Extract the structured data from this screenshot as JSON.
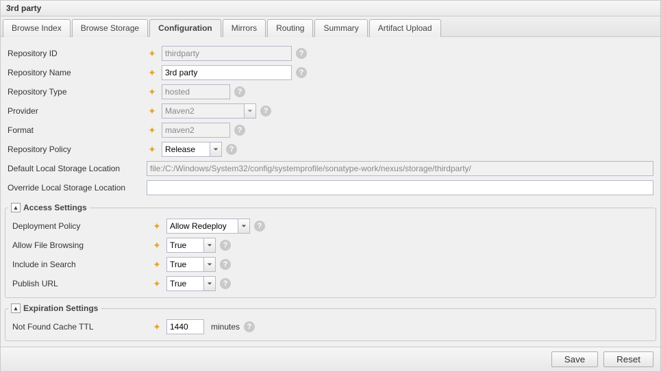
{
  "panel": {
    "title": "3rd party"
  },
  "tabs": [
    {
      "label": "Browse Index"
    },
    {
      "label": "Browse Storage"
    },
    {
      "label": "Configuration"
    },
    {
      "label": "Mirrors"
    },
    {
      "label": "Routing"
    },
    {
      "label": "Summary"
    },
    {
      "label": "Artifact Upload"
    }
  ],
  "active_tab": "Configuration",
  "fields": {
    "repo_id": {
      "label": "Repository ID",
      "value": "thirdparty",
      "readonly": true
    },
    "repo_name": {
      "label": "Repository Name",
      "value": "3rd party",
      "readonly": false
    },
    "repo_type": {
      "label": "Repository Type",
      "value": "hosted",
      "readonly": true
    },
    "provider": {
      "label": "Provider",
      "value": "Maven2",
      "readonly": true
    },
    "format": {
      "label": "Format",
      "value": "maven2",
      "readonly": true
    },
    "policy": {
      "label": "Repository Policy",
      "value": "Release"
    },
    "default_loc": {
      "label": "Default Local Storage Location",
      "value": "file:/C:/Windows/System32/config/systemprofile/sonatype-work/nexus/storage/thirdparty/",
      "readonly": true
    },
    "override_loc": {
      "label": "Override Local Storage Location",
      "value": ""
    }
  },
  "access": {
    "legend": "Access Settings",
    "deploy": {
      "label": "Deployment Policy",
      "value": "Allow Redeploy"
    },
    "browse": {
      "label": "Allow File Browsing",
      "value": "True"
    },
    "search": {
      "label": "Include in Search",
      "value": "True"
    },
    "publish": {
      "label": "Publish URL",
      "value": "True"
    }
  },
  "expiration": {
    "legend": "Expiration Settings",
    "nfttl": {
      "label": "Not Found Cache TTL",
      "value": "1440",
      "unit": "minutes"
    }
  },
  "buttons": {
    "save": "Save",
    "reset": "Reset"
  }
}
